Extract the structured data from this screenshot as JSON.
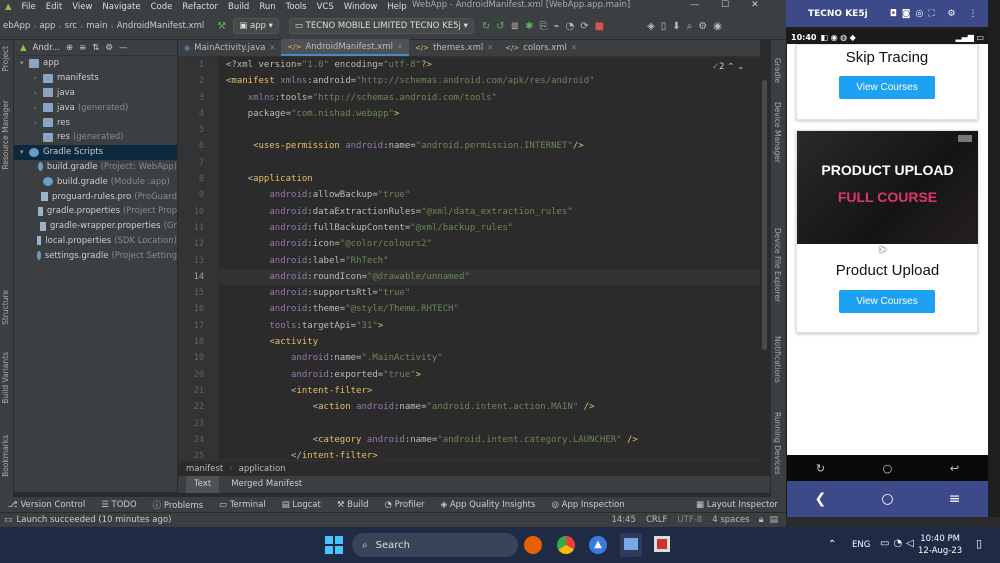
{
  "menu": {
    "items": [
      "File",
      "Edit",
      "View",
      "Navigate",
      "Code",
      "Refactor",
      "Build",
      "Run",
      "Tools",
      "VCS",
      "Window",
      "Help"
    ],
    "window_title": "WebApp - AndroidManifest.xml [WebApp.app.main]"
  },
  "toolbar": {
    "breadcrumb": [
      "ebApp",
      "app",
      "src",
      "main",
      "AndroidManifest.xml"
    ],
    "run_config": "app",
    "device": "TECNO MOBILE LIMITED TECNO KE5j"
  },
  "left_strip": {
    "project": "Project",
    "resource_manager": "Resource Manager",
    "structure": "Structure",
    "build_variants": "Build Variants",
    "bookmarks": "Bookmarks"
  },
  "project_panel": {
    "header": "Andr...",
    "items": [
      {
        "label": "app",
        "extra": "",
        "indent": 0,
        "arrow": "▾",
        "icon": "folder"
      },
      {
        "label": "manifests",
        "extra": "",
        "indent": 1,
        "arrow": "›",
        "icon": "folder"
      },
      {
        "label": "java",
        "extra": "",
        "indent": 1,
        "arrow": "›",
        "icon": "folder"
      },
      {
        "label": "java",
        "extra": "(generated)",
        "indent": 1,
        "arrow": "›",
        "icon": "folder"
      },
      {
        "label": "res",
        "extra": "",
        "indent": 1,
        "arrow": "›",
        "icon": "folder"
      },
      {
        "label": "res",
        "extra": "(generated)",
        "indent": 1,
        "arrow": "",
        "icon": "folder"
      },
      {
        "label": "Gradle Scripts",
        "extra": "",
        "indent": 0,
        "arrow": "▾",
        "icon": "gradle"
      },
      {
        "label": "build.gradle",
        "extra": "(Project: WebApp)",
        "indent": 1,
        "arrow": "",
        "icon": "gradle"
      },
      {
        "label": "build.gradle",
        "extra": "(Module :app)",
        "indent": 1,
        "arrow": "",
        "icon": "gradle"
      },
      {
        "label": "proguard-rules.pro",
        "extra": "(ProGuard",
        "indent": 1,
        "arrow": "",
        "icon": "file"
      },
      {
        "label": "gradle.properties",
        "extra": "(Project Prop",
        "indent": 1,
        "arrow": "",
        "icon": "file"
      },
      {
        "label": "gradle-wrapper.properties",
        "extra": "(Gr",
        "indent": 1,
        "arrow": "",
        "icon": "file"
      },
      {
        "label": "local.properties",
        "extra": "(SDK Location)",
        "indent": 1,
        "arrow": "",
        "icon": "file"
      },
      {
        "label": "settings.gradle",
        "extra": "(Project Setting",
        "indent": 1,
        "arrow": "",
        "icon": "gradle"
      }
    ]
  },
  "tabs": [
    {
      "label": "MainActivity.java",
      "active": false
    },
    {
      "label": "AndroidManifest.xml",
      "active": true
    },
    {
      "label": "themes.xml",
      "active": false
    },
    {
      "label": "colors.xml",
      "active": false
    }
  ],
  "editor": {
    "inspection_count": "2",
    "line_numbers": [
      "1",
      "2",
      "3",
      "4",
      "5",
      "6",
      "7",
      "8",
      "9",
      "10",
      "11",
      "12",
      "13",
      "14",
      "15",
      "16",
      "17",
      "18",
      "19",
      "20",
      "21",
      "22",
      "23",
      "24",
      "25"
    ],
    "current_line": "14",
    "lines": [
      "<?xml version=\"1.0\" encoding=\"utf-8\"?>",
      "<manifest xmlns:android=\"http://schemas.android.com/apk/res/android\"",
      "    xmlns:tools=\"http://schemas.android.com/tools\"",
      "    package=\"com.nishad.webapp\">",
      "",
      "     <uses-permission android:name=\"android.permission.INTERNET\"/>",
      "",
      "    <application",
      "        android:allowBackup=\"true\"",
      "        android:dataExtractionRules=\"@xml/data_extraction_rules\"",
      "        android:fullBackupContent=\"@xml/backup_rules\"",
      "        android:icon=\"@color/colours2\"",
      "        android:label=\"RhTech\"",
      "        android:roundIcon=\"@drawable/unnamed\"",
      "        android:supportsRtl=\"true\"",
      "        android:theme=\"@style/Theme.RHTECH\"",
      "        tools:targetApi=\"31\">",
      "        <activity",
      "            android:name=\".MainActivity\"",
      "            android:exported=\"true\">",
      "            <intent-filter>",
      "                <action android:name=\"android.intent.action.MAIN\" />",
      "",
      "                <category android:name=\"android.intent.category.LAUNCHER\" />",
      "            </intent-filter>"
    ],
    "breadcrumb": [
      "manifest",
      "application"
    ],
    "subtabs": [
      "Text",
      "Merged Manifest"
    ]
  },
  "right_strip": {
    "gradle": "Gradle",
    "device_manager": "Device Manager",
    "device_file_explorer": "Device File Explorer",
    "notifications": "Notifications",
    "running_devices": "Running Devices"
  },
  "tool_windows": [
    "Version Control",
    "TODO",
    "Problems",
    "Terminal",
    "Logcat",
    "Build",
    "Profiler",
    "App Quality Insights",
    "App Inspection",
    "Layout Inspector"
  ],
  "status": {
    "message": "Launch succeeded (10 minutes ago)",
    "position": "14:45",
    "line_sep": "CRLF",
    "encoding": "UTF-8",
    "indent": "4 spaces"
  },
  "phone": {
    "device_name": "TECNO KE5j",
    "time": "10:40",
    "card1_title": "Skip Tracing",
    "card1_button": "View Courses",
    "banner_line1": "PRODUCT UPLOAD",
    "banner_line2": "FULL COURSE",
    "card2_title": "Product Upload",
    "card2_button": "View Courses"
  },
  "taskbar": {
    "search_placeholder": "Search",
    "language": "ENG",
    "time": "10:40 PM",
    "date": "12-Aug-23"
  },
  "colors": {
    "accent": "#1da1f2",
    "phone_bar": "#3c4a8a",
    "banner_pink": "#e3346b"
  }
}
